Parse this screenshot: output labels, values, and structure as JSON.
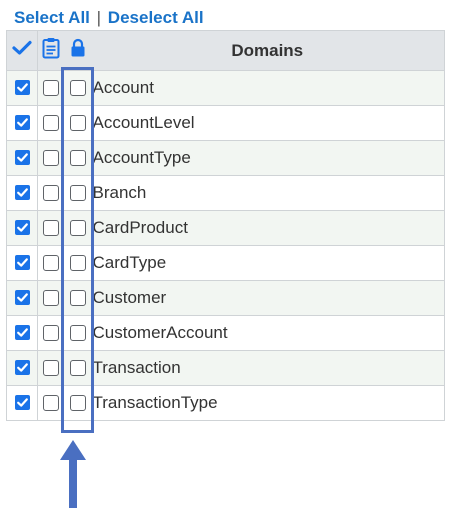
{
  "links": {
    "select_all": "Select All",
    "separator": "|",
    "deselect_all": "Deselect All"
  },
  "header": {
    "select_column_icon": "checkmark-icon",
    "doc_column_icon": "clipboard-icon",
    "lock_column_icon": "lock-icon",
    "domains_label": "Domains"
  },
  "rows": [
    {
      "name": "Account",
      "selected": true,
      "doc_checked": false,
      "lock_checked": false
    },
    {
      "name": "AccountLevel",
      "selected": true,
      "doc_checked": false,
      "lock_checked": false
    },
    {
      "name": "AccountType",
      "selected": true,
      "doc_checked": false,
      "lock_checked": false
    },
    {
      "name": "Branch",
      "selected": true,
      "doc_checked": false,
      "lock_checked": false
    },
    {
      "name": "CardProduct",
      "selected": true,
      "doc_checked": false,
      "lock_checked": false
    },
    {
      "name": "CardType",
      "selected": true,
      "doc_checked": false,
      "lock_checked": false
    },
    {
      "name": "Customer",
      "selected": true,
      "doc_checked": false,
      "lock_checked": false
    },
    {
      "name": "CustomerAccount",
      "selected": true,
      "doc_checked": false,
      "lock_checked": false
    },
    {
      "name": "Transaction",
      "selected": true,
      "doc_checked": false,
      "lock_checked": false
    },
    {
      "name": "TransactionType",
      "selected": true,
      "doc_checked": false,
      "lock_checked": false
    }
  ],
  "colors": {
    "link": "#1a73c8",
    "checkbox_checked": "#1a73e8",
    "annotation": "#4a6fc1",
    "header_bg": "#e2e5e8",
    "row_alt_bg": "#f2f6f2"
  }
}
